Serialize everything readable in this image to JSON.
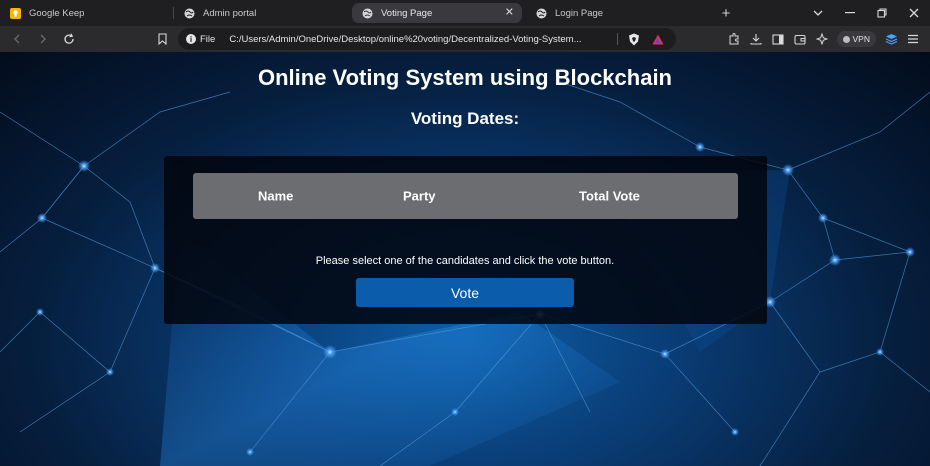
{
  "browser": {
    "tabs": [
      {
        "title": "Google Keep",
        "icon": "google-keep-icon",
        "active": false
      },
      {
        "title": "Admin portal",
        "icon": "globe-icon",
        "active": false
      },
      {
        "title": "Voting Page",
        "icon": "globe-icon",
        "active": true
      },
      {
        "title": "Login Page",
        "icon": "globe-icon",
        "active": false
      }
    ],
    "new_tab": "+",
    "address": {
      "scheme": "File",
      "url": "C:/Users/Admin/OneDrive/Desktop/online%20voting/Decentralized-Voting-System..."
    },
    "vpn_label": "VPN"
  },
  "page": {
    "title": "Online Voting System using Blockchain",
    "voting_dates_label": "Voting Dates:",
    "table": {
      "headers": [
        "Name",
        "Party",
        "Total Vote"
      ]
    },
    "instruction": "Please select one of the candidates and click the vote button.",
    "vote_button": "Vote"
  },
  "colors": {
    "accent": "#0b5cab",
    "table_header": "#6c6d70"
  }
}
